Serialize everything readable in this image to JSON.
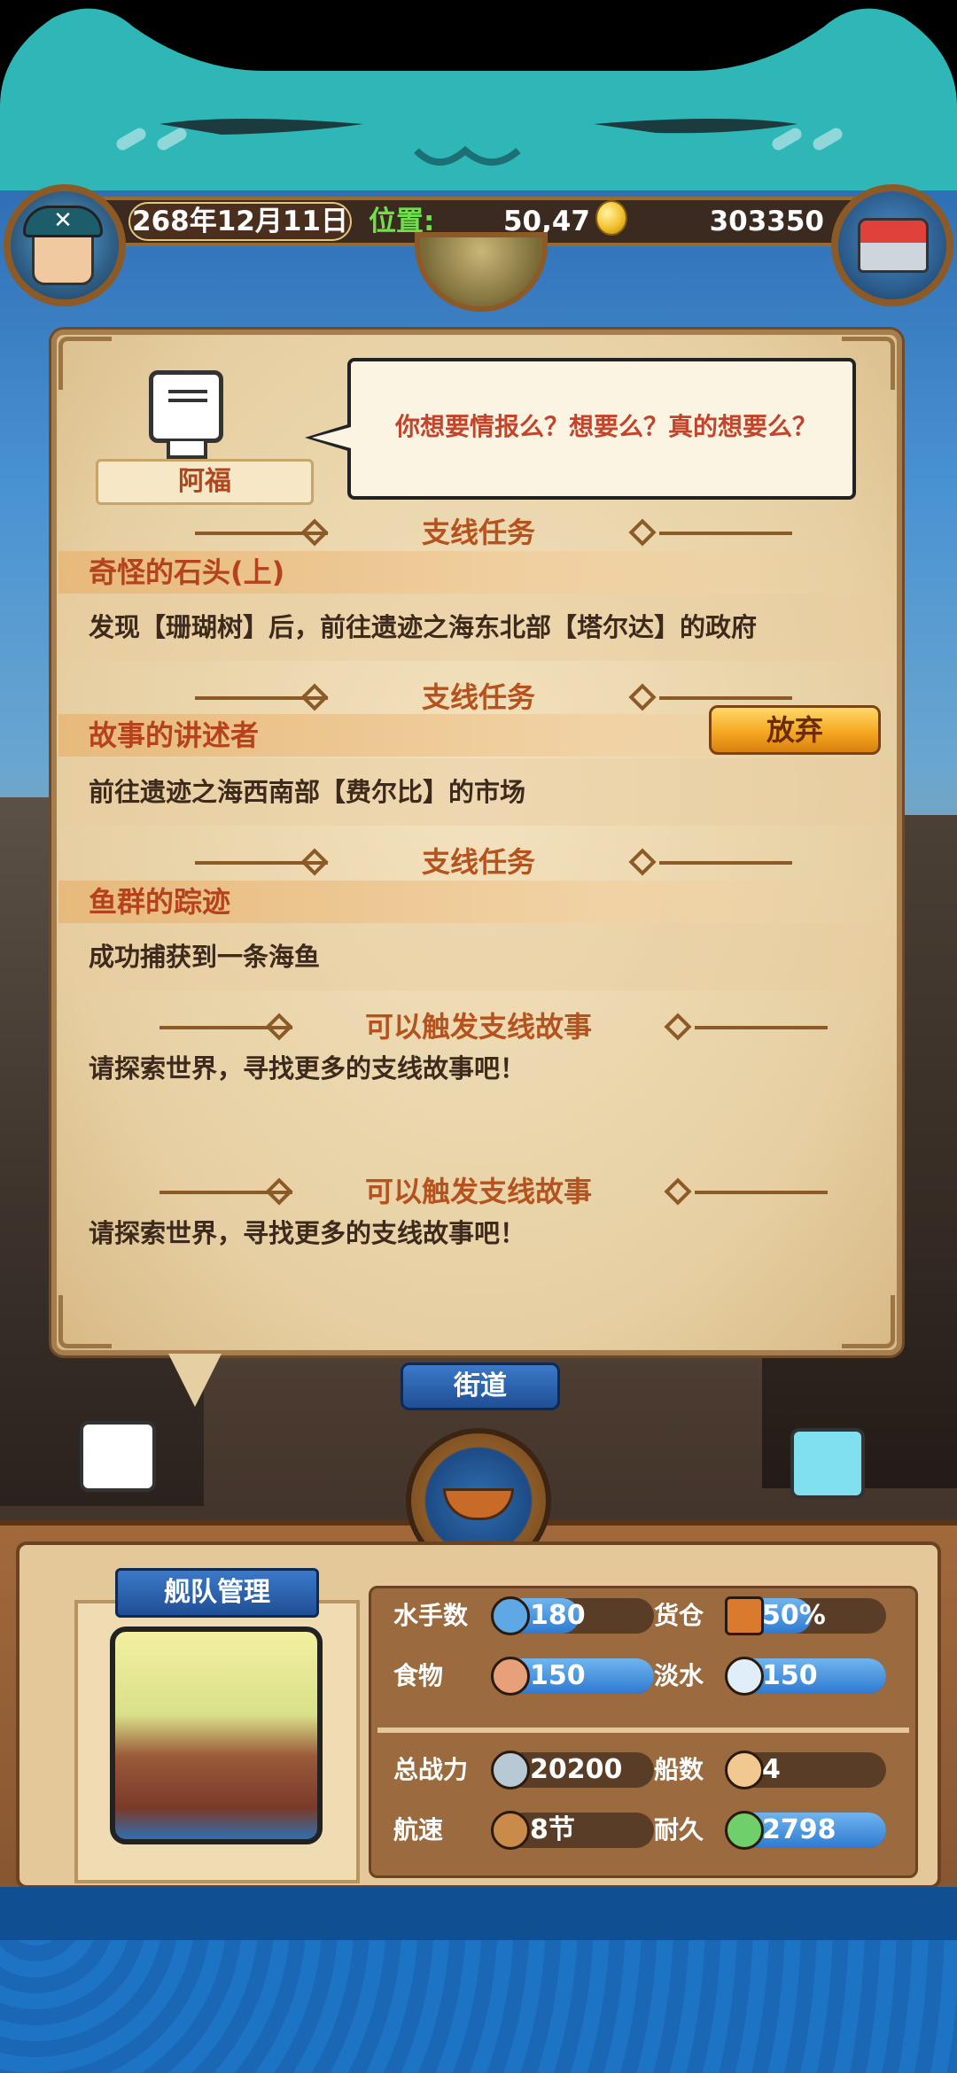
{
  "status": {
    "date": "268年12月11日",
    "position_label": "位置:",
    "position_value": "50,47",
    "gold": "303350"
  },
  "npc": {
    "name": "阿福",
    "dialogue": "你想要情报么？想要么？真的想要么？"
  },
  "quests": [
    {
      "section_title": "支线任务",
      "name": "奇怪的石头(上)",
      "description": "发现【珊瑚树】后，前往遗迹之海东北部【塔尔达】的政府"
    },
    {
      "section_title": "支线任务",
      "name": "故事的讲述者",
      "description": "前往遗迹之海西南部【费尔比】的市场",
      "action_label": "放弃"
    },
    {
      "section_title": "支线任务",
      "name": "鱼群的踪迹",
      "description": "成功捕获到一条海鱼"
    }
  ],
  "triggerable": [
    {
      "section_title": "可以触发支线故事",
      "description": "请探索世界，寻找更多的支线故事吧！"
    },
    {
      "section_title": "可以触发支线故事",
      "description": "请探索世界，寻找更多的支线故事吧！"
    }
  ],
  "location_tab": "街道",
  "fleet": {
    "title": "舰队管理",
    "stats": [
      {
        "label": "水手数",
        "value": "180",
        "icon": "sailor-icon",
        "fill": 0.5
      },
      {
        "label": "货仓",
        "value": "50%",
        "icon": "cargo-icon",
        "fill": 0.5
      },
      {
        "label": "食物",
        "value": "150",
        "icon": "meat-icon",
        "fill": 1.0
      },
      {
        "label": "淡水",
        "value": "150",
        "icon": "water-jug-icon",
        "fill": 1.0
      },
      {
        "label": "总战力",
        "value": "20200",
        "icon": "swords-icon",
        "fill": 0.0
      },
      {
        "label": "船数",
        "value": "4",
        "icon": "ship-count-icon",
        "fill": 0.0
      },
      {
        "label": "航速",
        "value": "8节",
        "icon": "sailboat-icon",
        "fill": 0.0
      },
      {
        "label": "耐久",
        "value": "2798",
        "icon": "durability-ship-icon",
        "fill": 1.0
      }
    ]
  },
  "colors": {
    "accent_title": "#b5521e",
    "quest_name": "#b5421b",
    "position_label": "#6fe04a",
    "stat_fill": "#2f7ad1"
  }
}
